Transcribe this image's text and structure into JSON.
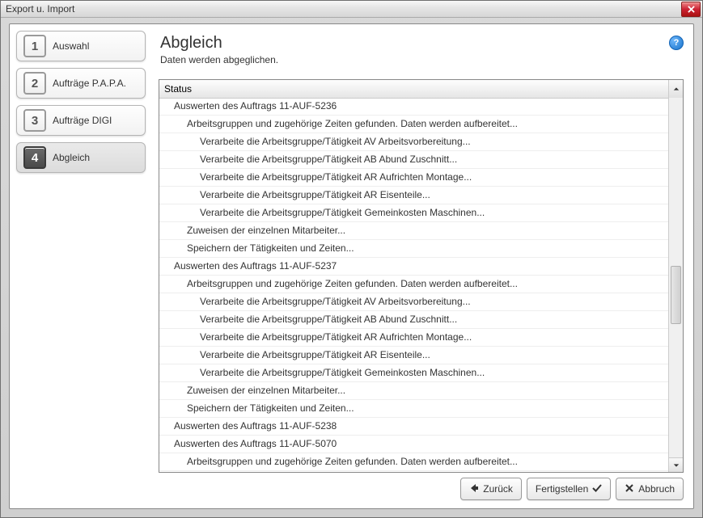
{
  "window": {
    "title": "Export u. Import"
  },
  "sidebar": {
    "steps": [
      {
        "num": "1",
        "label": "Auswahl"
      },
      {
        "num": "2",
        "label": "Aufträge P.A.P.A."
      },
      {
        "num": "3",
        "label": "Aufträge DIGI"
      },
      {
        "num": "4",
        "label": "Abgleich"
      }
    ],
    "active_index": 3
  },
  "page": {
    "title": "Abgleich",
    "subtitle": "Daten werden abgeglichen."
  },
  "list": {
    "header": "Status",
    "rows": [
      {
        "indent": 0,
        "text": "Auswerten des Auftrags 11-AUF-5236"
      },
      {
        "indent": 1,
        "text": "Arbeitsgruppen und zugehörige Zeiten gefunden. Daten werden aufbereitet..."
      },
      {
        "indent": 2,
        "text": "Verarbeite die Arbeitsgruppe/Tätigkeit AV Arbeitsvorbereitung..."
      },
      {
        "indent": 2,
        "text": "Verarbeite die Arbeitsgruppe/Tätigkeit AB Abund Zuschnitt..."
      },
      {
        "indent": 2,
        "text": "Verarbeite die Arbeitsgruppe/Tätigkeit AR Aufrichten Montage..."
      },
      {
        "indent": 2,
        "text": "Verarbeite die Arbeitsgruppe/Tätigkeit AR Eisenteile..."
      },
      {
        "indent": 2,
        "text": "Verarbeite die Arbeitsgruppe/Tätigkeit Gemeinkosten Maschinen..."
      },
      {
        "indent": 1,
        "text": "Zuweisen der einzelnen Mitarbeiter..."
      },
      {
        "indent": 1,
        "text": "Speichern der Tätigkeiten und Zeiten..."
      },
      {
        "indent": 0,
        "text": "Auswerten des Auftrags 11-AUF-5237"
      },
      {
        "indent": 1,
        "text": "Arbeitsgruppen und zugehörige Zeiten gefunden. Daten werden aufbereitet..."
      },
      {
        "indent": 2,
        "text": "Verarbeite die Arbeitsgruppe/Tätigkeit AV Arbeitsvorbereitung..."
      },
      {
        "indent": 2,
        "text": "Verarbeite die Arbeitsgruppe/Tätigkeit AB Abund Zuschnitt..."
      },
      {
        "indent": 2,
        "text": "Verarbeite die Arbeitsgruppe/Tätigkeit AR Aufrichten Montage..."
      },
      {
        "indent": 2,
        "text": "Verarbeite die Arbeitsgruppe/Tätigkeit AR Eisenteile..."
      },
      {
        "indent": 2,
        "text": "Verarbeite die Arbeitsgruppe/Tätigkeit Gemeinkosten Maschinen..."
      },
      {
        "indent": 1,
        "text": "Zuweisen der einzelnen Mitarbeiter..."
      },
      {
        "indent": 1,
        "text": "Speichern der Tätigkeiten und Zeiten..."
      },
      {
        "indent": 0,
        "text": "Auswerten des Auftrags 11-AUF-5238"
      },
      {
        "indent": 0,
        "text": "Auswerten des Auftrags 11-AUF-5070"
      },
      {
        "indent": 1,
        "text": "Arbeitsgruppen und zugehörige Zeiten gefunden. Daten werden aufbereitet..."
      }
    ]
  },
  "buttons": {
    "back": "Zurück",
    "finish": "Fertigstellen",
    "cancel": "Abbruch"
  }
}
